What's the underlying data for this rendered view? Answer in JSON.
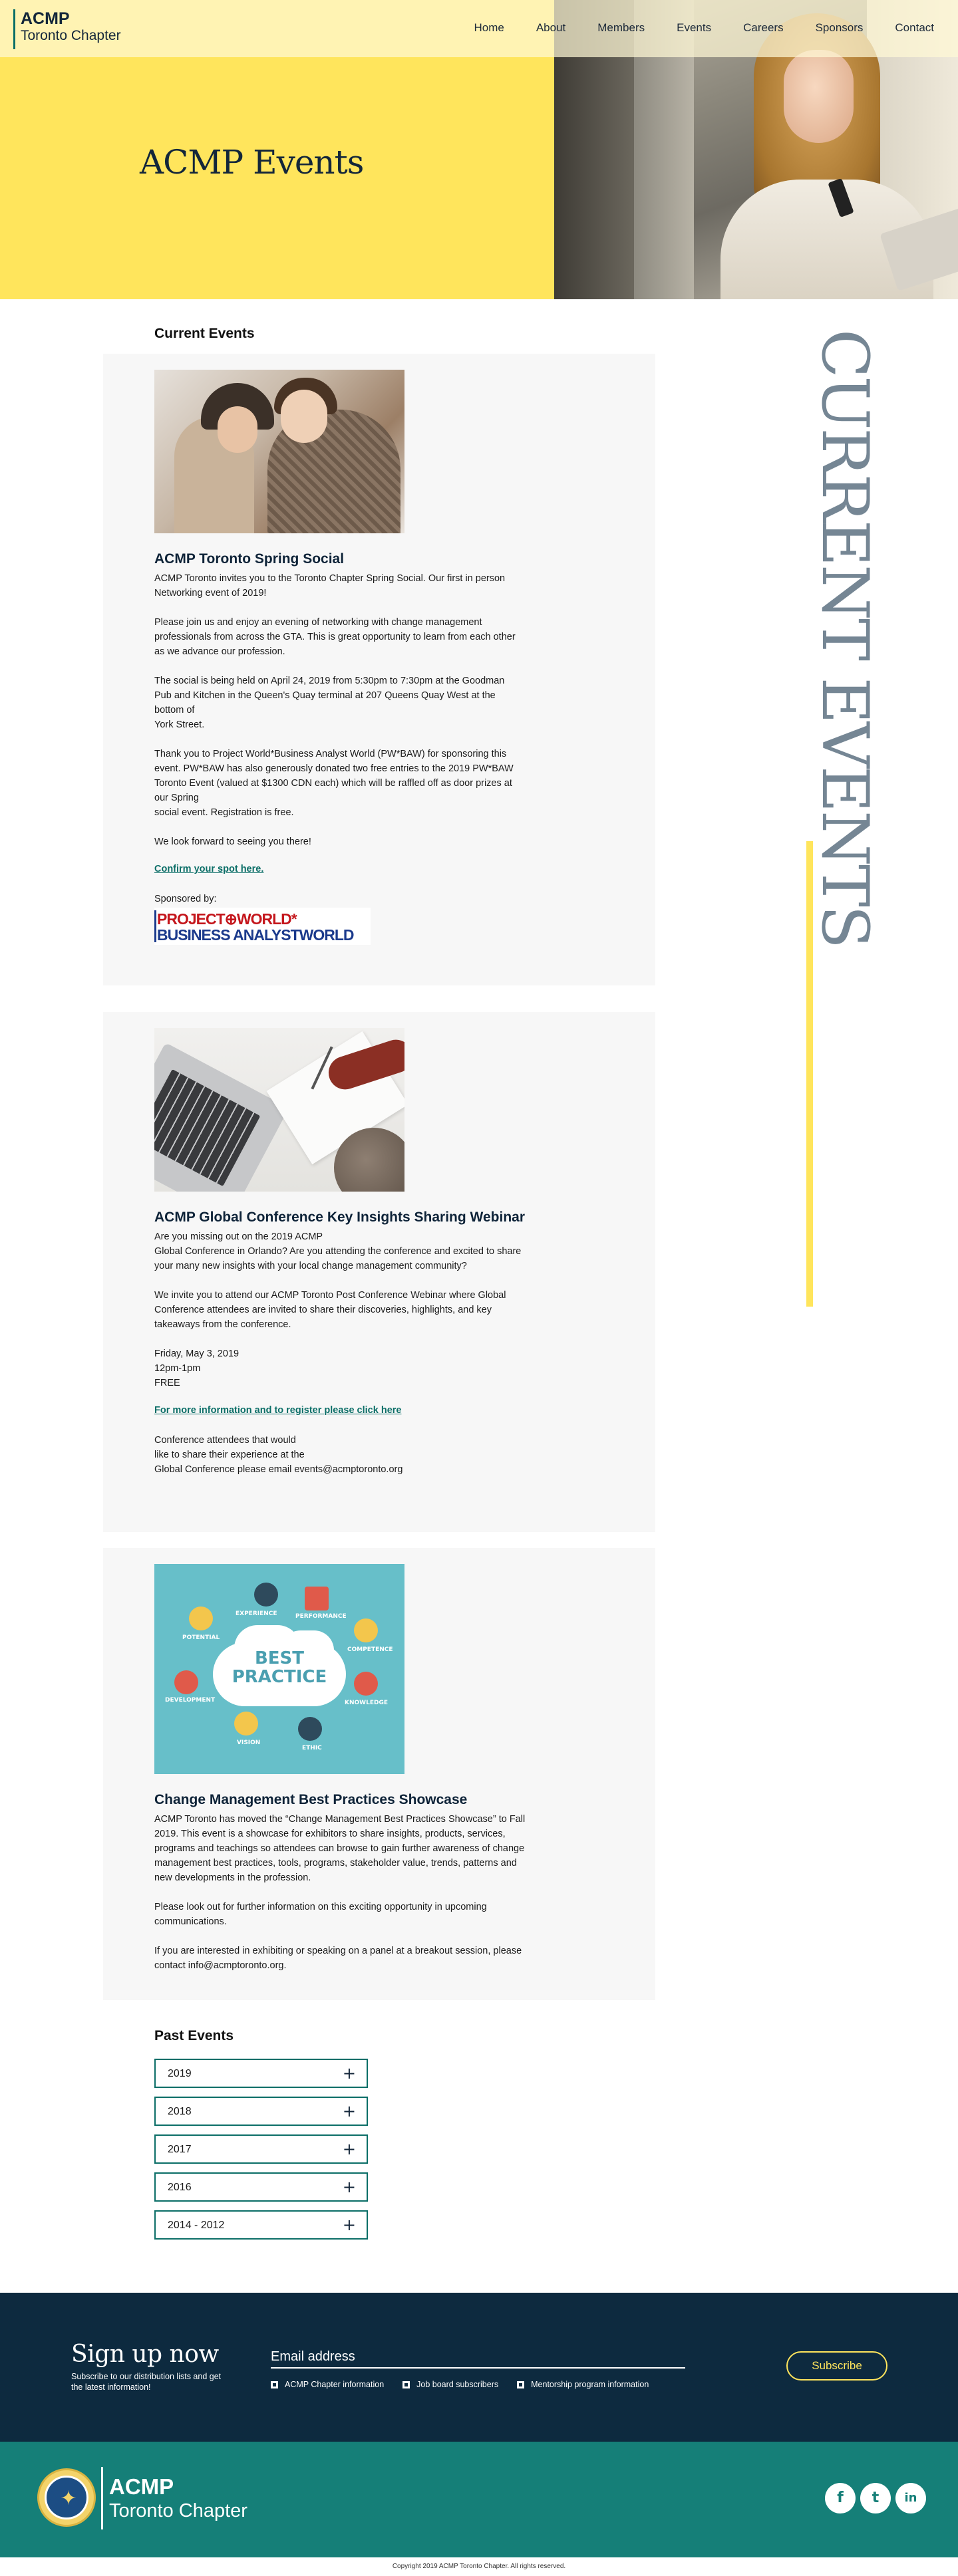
{
  "header": {
    "logo_main": "ACMP",
    "logo_sub": "Toronto Chapter",
    "nav": [
      "Home",
      "About",
      "Members",
      "Events",
      "Careers",
      "Sponsors",
      "Contact"
    ],
    "hero_title": "ACMP Events"
  },
  "side_heading": "CURRENT EVENTS",
  "current_events": {
    "heading": "Current Events",
    "events": [
      {
        "title": "ACMP Toronto Spring Social",
        "paragraphs": [
          "ACMP Toronto invites you to the Toronto Chapter Spring Social. Our first in person\nNetworking event of 2019!",
          "Please join us and enjoy an evening of networking with change management\nprofessionals from across the GTA.  This is great opportunity to learn from each other\nas we advance our profession.",
          "The social is being held on April 24, 2019 from 5:30pm to 7:30pm at the Goodman\nPub and Kitchen in the Queen's Quay terminal at 207 Queens Quay West at the\nbottom of\nYork Street.",
          "Thank you to Project World*Business Analyst World (PW*BAW) for sponsoring this\nevent.  PW*BAW has also generously donated two free entries to the 2019 PW*BAW\nToronto Event (valued at $1300 CDN each) which will be raffled off as door prizes at\nour Spring\nsocial event. Registration is free.",
          "We look forward to seeing you there!"
        ],
        "link": "Confirm your spot here.",
        "sponsored_by": "Sponsored by:",
        "sponsor_line1": "PROJECT⊕WORLD*",
        "sponsor_line2": "BUSINESS ANALYSTWORLD"
      },
      {
        "title": "ACMP Global Conference Key Insights Sharing Webinar",
        "paragraphs": [
          "Are you missing out on the 2019 ACMP\nGlobal Conference in Orlando? Are you attending the conference and excited to share\nyour many new insights with your local change management community?",
          "We invite you to attend our ACMP Toronto Post Conference Webinar where Global\nConference attendees are invited to share their discoveries, highlights, and key\ntakeaways from the conference.",
          "Friday, May 3, 2019\n12pm-1pm\nFREE"
        ],
        "link": "For more information and to register please click here ",
        "after_link": "Conference attendees that would\nlike to share their experience at the\nGlobal Conference please email events@acmptoronto.org"
      },
      {
        "title": "Change Management Best Practices Showcase",
        "paragraphs": [
          "ACMP Toronto has moved the “Change Management Best Practices Showcase” to Fall\n2019. This event is a showcase for exhibitors to share insights, products, services,\nprograms and teachings so attendees can browse to gain further awareness of change\nmanagement best practices, tools, programs, stakeholder value, trends, patterns and\nnew developments in the profession.",
          "Please look out for further information on this exciting opportunity in upcoming\ncommunications.",
          "If you are interested in exhibiting or speaking on a panel at a breakout session, please\ncontact info@acmptoronto.org."
        ],
        "image_text": {
          "center_line1": "BEST",
          "center_line2": "PRACTICE",
          "labels": [
            "EXPERIENCE",
            "PERFORMANCE",
            "POTENTIAL",
            "COMPETENCE",
            "DEVELOPMENT",
            "KNOWLEDGE",
            "VISION",
            "ETHIC"
          ]
        }
      }
    ]
  },
  "past_events": {
    "heading": "Past Events",
    "years": [
      "2019",
      "2018",
      "2017",
      "2016",
      "2014 - 2012"
    ],
    "expand_icon": "plus-icon"
  },
  "signup": {
    "title": "Sign up now",
    "subtitle": "Subscribe to our distribution lists and get the latest information!",
    "email_placeholder": "Email address",
    "options": [
      "ACMP Chapter information",
      "Job board subscribers",
      "Mentorship program information"
    ],
    "button": "Subscribe"
  },
  "footer": {
    "org_main": "ACMP",
    "org_sub": "Toronto Chapter",
    "social_icons": [
      "facebook-icon",
      "twitter-icon",
      "linkedin-icon"
    ],
    "social_glyphs": [
      "f",
      "t",
      "in"
    ],
    "copyright": "Copyright 2019 ACMP Toronto Chapter. All rights reserved."
  },
  "colors": {
    "accent_yellow": "#ffe55c",
    "teal": "#157f78",
    "navy": "#0d2a3f",
    "side_heading_grey": "#758694"
  }
}
